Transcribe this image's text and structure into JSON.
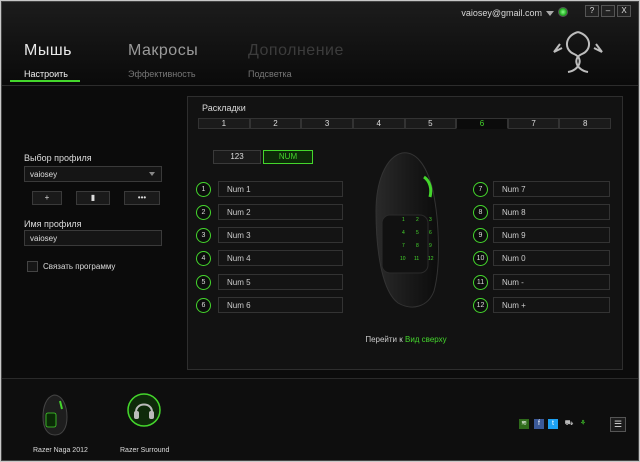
{
  "account": {
    "email": "vaiosey@gmail.com"
  },
  "window_buttons": {
    "help": "?",
    "minimize": "–",
    "close": "X"
  },
  "main_tabs": [
    {
      "label": "Мышь"
    },
    {
      "label": "Макросы"
    },
    {
      "label": "Дополнение"
    }
  ],
  "sub_tabs": [
    {
      "label": "Настроить"
    },
    {
      "label": "Эффективность"
    },
    {
      "label": "Подсветка"
    }
  ],
  "profile": {
    "select_label": "Выбор профиля",
    "selected": "vaiosey",
    "add_label": "+",
    "delete_label": "▮",
    "more_label": "•••",
    "name_label": "Имя профиля",
    "name_value": "vaiosey",
    "link_program_label": "Связать программу"
  },
  "layouts": {
    "title": "Раскладки",
    "tabs": [
      "1",
      "2",
      "3",
      "4",
      "5",
      "6",
      "7",
      "8"
    ],
    "active_tab": "6",
    "mode_123": "123",
    "mode_num": "NUM",
    "left_rows": [
      {
        "num": "1",
        "value": "Num 1"
      },
      {
        "num": "2",
        "value": "Num 2"
      },
      {
        "num": "3",
        "value": "Num 3"
      },
      {
        "num": "4",
        "value": "Num 4"
      },
      {
        "num": "5",
        "value": "Num 5"
      },
      {
        "num": "6",
        "value": "Num 6"
      }
    ],
    "right_rows": [
      {
        "num": "7",
        "value": "Num 7"
      },
      {
        "num": "8",
        "value": "Num 8"
      },
      {
        "num": "9",
        "value": "Num 9"
      },
      {
        "num": "10",
        "value": "Num 0"
      },
      {
        "num": "11",
        "value": "Num -"
      },
      {
        "num": "12",
        "value": "Num +"
      }
    ],
    "mouse_keys": [
      "1",
      "2",
      "3",
      "4",
      "5",
      "6",
      "7",
      "8",
      "9",
      "10",
      "11",
      "12"
    ],
    "goto_prefix": "Перейти к",
    "goto_link": "Вид сверху"
  },
  "devices": [
    {
      "label": "Razer Naga 2012"
    },
    {
      "label": "Razer Surround"
    }
  ],
  "colors": {
    "accent": "#44d62c",
    "bg": "#0b0b0b"
  }
}
